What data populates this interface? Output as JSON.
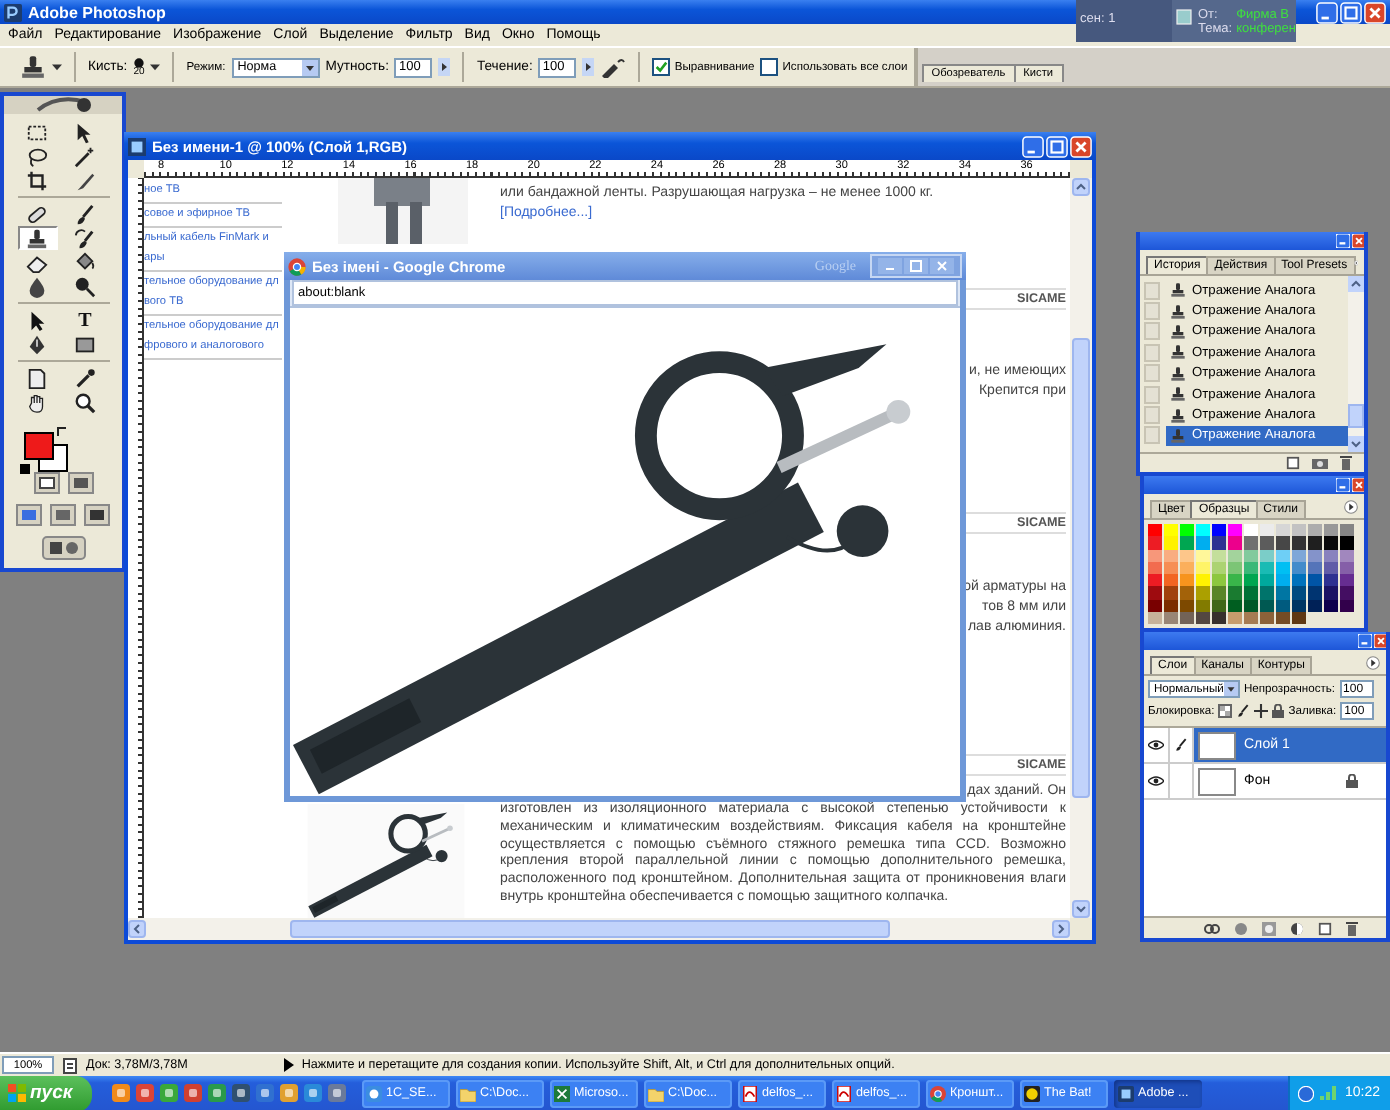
{
  "app": {
    "title": "Adobe Photoshop"
  },
  "notifier": {
    "text": "сен: 1",
    "from_label": "От:",
    "from": "Фирма В",
    "subject_label": "Тема:",
    "subject": "конферен"
  },
  "menu": [
    "Файл",
    "Редактирование",
    "Изображение",
    "Слой",
    "Выделение",
    "Фильтр",
    "Вид",
    "Окно",
    "Помощь"
  ],
  "options": {
    "brush_label": "Кисть:",
    "brush_size": "20",
    "mode_label": "Режим:",
    "mode": "Норма",
    "opacity_label": "Мутность:",
    "opacity": "100",
    "flow_label": "Течение:",
    "flow": "100",
    "checkboxes": [
      {
        "label": "Выравнивание",
        "checked": true
      },
      {
        "label": "Использовать все слои",
        "checked": false
      }
    ],
    "well_tabs": [
      {
        "label": "Обозреватель",
        "selected": false
      },
      {
        "label": "Кисти",
        "selected": false
      }
    ]
  },
  "toolbox": {
    "tools": [
      {
        "kind": "marquee",
        "selected": false
      },
      {
        "kind": "move",
        "selected": false
      },
      {
        "kind": "lasso",
        "selected": false
      },
      {
        "kind": "magic-wand",
        "selected": false
      },
      {
        "kind": "crop",
        "selected": false
      },
      {
        "kind": "slice",
        "selected": false
      },
      {
        "kind": "healing",
        "selected": false
      },
      {
        "kind": "brush",
        "selected": false
      },
      {
        "kind": "stamp",
        "selected": true
      },
      {
        "kind": "history-brush",
        "selected": false
      },
      {
        "kind": "eraser",
        "selected": false
      },
      {
        "kind": "bucket",
        "selected": false
      },
      {
        "kind": "blur",
        "selected": false
      },
      {
        "kind": "dodge",
        "selected": false
      },
      {
        "kind": "path-select",
        "selected": false
      },
      {
        "kind": "type",
        "glyph": "T",
        "selected": false
      },
      {
        "kind": "pen",
        "selected": false
      },
      {
        "kind": "shape",
        "selected": false
      },
      {
        "kind": "notes",
        "selected": false
      },
      {
        "kind": "eyedropper",
        "selected": false
      },
      {
        "kind": "hand",
        "selected": false
      },
      {
        "kind": "zoom",
        "selected": false
      }
    ]
  },
  "document": {
    "title": "Без имени-1 @ 100% (Слой 1,RGB)",
    "ruler_numbers": [
      "8",
      "10",
      "12",
      "14",
      "16",
      "18",
      "20",
      "22",
      "24",
      "26",
      "28",
      "30",
      "32",
      "34",
      "36"
    ],
    "links": [
      {
        "lines": [
          "ное ТВ"
        ]
      },
      {
        "lines": [
          "совое и эфирное ТВ"
        ]
      },
      {
        "lines": [
          "льный кабель FinMark и",
          "ары"
        ]
      },
      {
        "lines": [
          "тельное оборудование дл",
          "вого ТВ"
        ]
      },
      {
        "lines": [
          "тельное оборудование дл",
          "фрового и аналогового"
        ]
      }
    ],
    "content": [
      {
        "kind": "text",
        "text": "или бандажной ленты. Разрушающая нагрузка – не менее 1000 кг."
      },
      {
        "kind": "link",
        "text": "[Подробнее...]"
      },
      {
        "kind": "brand",
        "text": "SICAME"
      },
      {
        "kind": "fragment",
        "text": "и, не имеющих"
      },
      {
        "kind": "fragment",
        "text": "Крепится при"
      },
      {
        "kind": "brand",
        "text": "SICAME"
      },
      {
        "kind": "fragment",
        "text": "ой арматуры на"
      },
      {
        "kind": "fragment",
        "text": "тов 8 мм или"
      },
      {
        "kind": "fragment",
        "text": "лав алюминия."
      },
      {
        "kind": "brand",
        "text": "SICAME"
      },
      {
        "kind": "fragment",
        "text": "дах зданий. Он"
      },
      {
        "kind": "paragraph",
        "text": "изготовлен из изоляционного материала с высокой степенью устойчивости к механическим и климатическим воздействиям. Фиксация кабеля на кронштейне осуществляется с помощью съёмного стяжного ремешка типа CCD. Возможно крепления второй параллельной линии с помощью дополнительного ремешка, расположенного под кронштейном. Дополнительная защита от проникновения влаги внутрь кронштейна обеспечивается с помощью защитного колпачка."
      }
    ]
  },
  "browser": {
    "title": "Без імені - Google Chrome",
    "brand": "Google",
    "address": "about:blank"
  },
  "history": {
    "tabs": [
      {
        "label": "История",
        "selected": true
      },
      {
        "label": "Действия",
        "selected": false
      },
      {
        "label": "Tool Presets",
        "selected": false
      }
    ],
    "items": [
      {
        "label": "Отражение Аналога",
        "selected": false
      },
      {
        "label": "Отражение Аналога",
        "selected": false
      },
      {
        "label": "Отражение Аналога",
        "selected": false
      },
      {
        "label": "Отражение Аналога",
        "selected": false
      },
      {
        "label": "Отражение Аналога",
        "selected": false
      },
      {
        "label": "Отражение Аналога",
        "selected": false
      },
      {
        "label": "Отражение Аналога",
        "selected": false
      },
      {
        "label": "Отражение Аналога",
        "selected": true
      }
    ]
  },
  "swatches_panel": {
    "tabs": [
      {
        "label": "Цвет",
        "selected": false
      },
      {
        "label": "Образцы",
        "selected": true
      },
      {
        "label": "Стили",
        "selected": false
      }
    ],
    "swatches": [
      {
        "color": "#ff0000"
      },
      {
        "color": "#ffff00"
      },
      {
        "color": "#00ff00"
      },
      {
        "color": "#00ffff"
      },
      {
        "color": "#0000ff"
      },
      {
        "color": "#ff00ff"
      },
      {
        "color": "#ffffff"
      },
      {
        "color": "#ebebeb"
      },
      {
        "color": "#d6d6d6"
      },
      {
        "color": "#c2c2c2"
      },
      {
        "color": "#adadad"
      },
      {
        "color": "#999999"
      },
      {
        "color": "#858585"
      },
      {
        "color": "#ed1c24"
      },
      {
        "color": "#fff200"
      },
      {
        "color": "#00a651"
      },
      {
        "color": "#00aeef"
      },
      {
        "color": "#2e3192"
      },
      {
        "color": "#ec008c"
      },
      {
        "color": "#707070"
      },
      {
        "color": "#5c5c5c"
      },
      {
        "color": "#474747"
      },
      {
        "color": "#333333"
      },
      {
        "color": "#1f1f1f"
      },
      {
        "color": "#0a0a0a"
      },
      {
        "color": "#000000"
      },
      {
        "color": "#f7977a"
      },
      {
        "color": "#f9ad81"
      },
      {
        "color": "#fdc68a"
      },
      {
        "color": "#fff79a"
      },
      {
        "color": "#c4df9b"
      },
      {
        "color": "#a3d39c"
      },
      {
        "color": "#82ca9d"
      },
      {
        "color": "#7bcdc8"
      },
      {
        "color": "#6ecff6"
      },
      {
        "color": "#7ea7d8"
      },
      {
        "color": "#8493ca"
      },
      {
        "color": "#8882be"
      },
      {
        "color": "#a187be"
      },
      {
        "color": "#f26c4f"
      },
      {
        "color": "#f68e55"
      },
      {
        "color": "#fbaf5c"
      },
      {
        "color": "#fff467"
      },
      {
        "color": "#acd372"
      },
      {
        "color": "#7cc576"
      },
      {
        "color": "#3bb878"
      },
      {
        "color": "#1abbb4"
      },
      {
        "color": "#00bff3"
      },
      {
        "color": "#438ccb"
      },
      {
        "color": "#5574b9"
      },
      {
        "color": "#605ca8"
      },
      {
        "color": "#855fa8"
      },
      {
        "color": "#ed1c23"
      },
      {
        "color": "#f26522"
      },
      {
        "color": "#f7941d"
      },
      {
        "color": "#fff201"
      },
      {
        "color": "#8dc73f"
      },
      {
        "color": "#39b54a"
      },
      {
        "color": "#00a650"
      },
      {
        "color": "#00a99d"
      },
      {
        "color": "#00aeee"
      },
      {
        "color": "#0072bc"
      },
      {
        "color": "#0054a6"
      },
      {
        "color": "#2e3191"
      },
      {
        "color": "#662d91"
      },
      {
        "color": "#9e0b0f"
      },
      {
        "color": "#a0410d"
      },
      {
        "color": "#a36209"
      },
      {
        "color": "#aba000"
      },
      {
        "color": "#598527"
      },
      {
        "color": "#1a7b30"
      },
      {
        "color": "#007236"
      },
      {
        "color": "#00746b"
      },
      {
        "color": "#0076a3"
      },
      {
        "color": "#004b80"
      },
      {
        "color": "#003471"
      },
      {
        "color": "#1b1464"
      },
      {
        "color": "#440e62"
      },
      {
        "color": "#790000"
      },
      {
        "color": "#7b2e00"
      },
      {
        "color": "#7d4900"
      },
      {
        "color": "#827b00"
      },
      {
        "color": "#406618"
      },
      {
        "color": "#005e20"
      },
      {
        "color": "#005826"
      },
      {
        "color": "#005952"
      },
      {
        "color": "#005b7f"
      },
      {
        "color": "#003663"
      },
      {
        "color": "#002157"
      },
      {
        "color": "#0d004c"
      },
      {
        "color": "#32004b"
      },
      {
        "color": "#c7b299"
      },
      {
        "color": "#998675"
      },
      {
        "color": "#736357"
      },
      {
        "color": "#534741"
      },
      {
        "color": "#37302d"
      },
      {
        "color": "#c69c6d"
      },
      {
        "color": "#a67c52"
      },
      {
        "color": "#8c6239"
      },
      {
        "color": "#754c24"
      },
      {
        "color": "#603913"
      }
    ]
  },
  "layers": {
    "tabs": [
      {
        "label": "Слои",
        "selected": true
      },
      {
        "label": "Каналы",
        "selected": false
      },
      {
        "label": "Контуры",
        "selected": false
      }
    ],
    "blend_mode": "Нормальный",
    "opacity_label": "Непрозрачность:",
    "opacity": "100",
    "lock_label": "Блокировка:",
    "fill_label": "Заливка:",
    "fill": "100",
    "items": [
      {
        "name": "Слой 1",
        "selected": true,
        "visible": true,
        "locked": false
      },
      {
        "name": "Фон",
        "selected": false,
        "visible": true,
        "locked": true
      }
    ]
  },
  "status": {
    "zoom": "100%",
    "doc_size": "Док: 3,78M/3,78M",
    "hint": "Нажмите и перетащите для создания копии. Используйте Shift, Alt, и Ctrl для дополнительных опций."
  },
  "taskbar": {
    "start": "пуск",
    "clock": "10:22",
    "tasks": [
      {
        "label": "1С_SE...",
        "kind": "app",
        "selected": false
      },
      {
        "label": "C:\\Doc...",
        "kind": "folder",
        "selected": false
      },
      {
        "label": "Microso...",
        "kind": "excel",
        "selected": false
      },
      {
        "label": "C:\\Doc...",
        "kind": "folder",
        "selected": false
      },
      {
        "label": "delfos_...",
        "kind": "pdf",
        "selected": false
      },
      {
        "label": "delfos_...",
        "kind": "pdf",
        "selected": false
      },
      {
        "label": "Кроншт...",
        "kind": "chrome",
        "selected": false
      },
      {
        "label": "The Bat!",
        "kind": "bat",
        "selected": false
      },
      {
        "label": "Adobe ...",
        "kind": "photoshop",
        "selected": true
      }
    ]
  }
}
